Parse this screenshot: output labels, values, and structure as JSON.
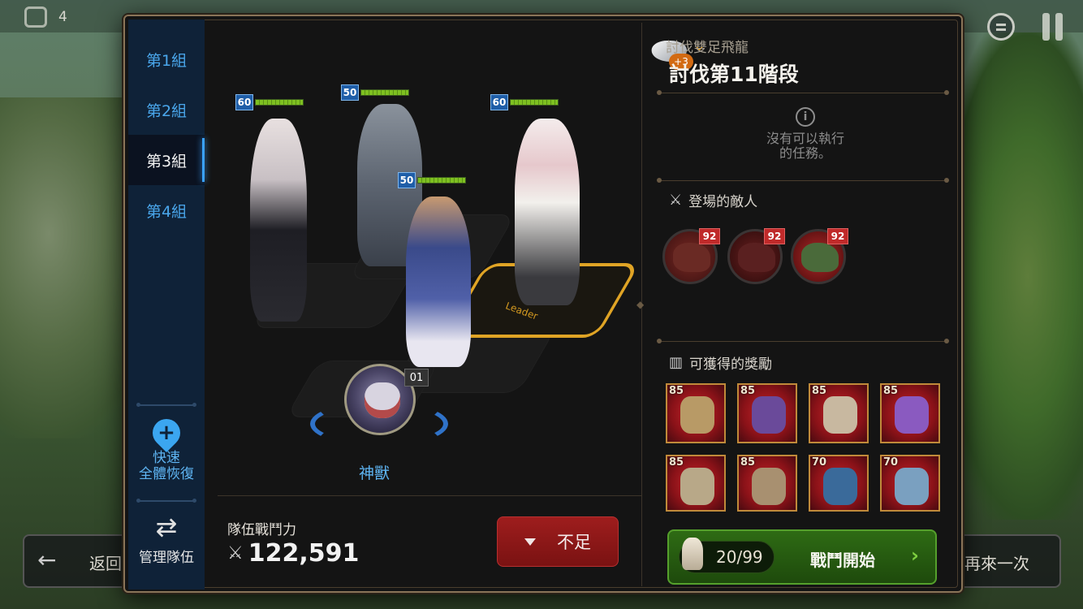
{
  "background": {
    "top_stat_value": "4",
    "back_label": "返回",
    "retry_label": "再來一次"
  },
  "tabs": [
    {
      "label": "第1組",
      "active": false
    },
    {
      "label": "第2組",
      "active": false
    },
    {
      "label": "第3組",
      "active": true
    },
    {
      "label": "第4組",
      "active": false
    }
  ],
  "sidebar": {
    "heal_line1": "快速",
    "heal_line2": "全體恢復",
    "manage_label": "管理隊伍"
  },
  "formation": {
    "buff_badge": "+3",
    "leader_text": "Leader",
    "heroes": [
      {
        "level": "60",
        "hp_percent": 100
      },
      {
        "level": "50",
        "hp_percent": 100
      },
      {
        "level": "60",
        "hp_percent": 100
      },
      {
        "level": "50",
        "hp_percent": 100
      }
    ],
    "beast": {
      "number": "01",
      "name": "神獸"
    }
  },
  "power": {
    "label": "隊伍戰鬥力",
    "value": "122,591"
  },
  "insufficient_label": "不足",
  "stage": {
    "subtitle": "討伐雙足飛龍",
    "title": "討伐第11階段"
  },
  "mission": {
    "line1": "沒有可以執行",
    "line2": "的任務。"
  },
  "enemies": {
    "heading": "登場的敵人",
    "list": [
      {
        "level": "92",
        "color": "#6a2a24"
      },
      {
        "level": "92",
        "color": "#5a2020"
      },
      {
        "level": "92",
        "color": "#4a6a3a"
      }
    ]
  },
  "rewards": {
    "heading": "可獲得的獎勵",
    "items": [
      {
        "level": "85",
        "color": "#b89a66"
      },
      {
        "level": "85",
        "color": "#6a4a9a"
      },
      {
        "level": "85",
        "color": "#c8b8a0"
      },
      {
        "level": "85",
        "color": "#8a5ac0"
      },
      {
        "level": "85",
        "color": "#b8a888"
      },
      {
        "level": "85",
        "color": "#a89070"
      },
      {
        "level": "70",
        "color": "#3a6a9a"
      },
      {
        "level": "70",
        "color": "#7aa0c0"
      }
    ]
  },
  "battle": {
    "cost": "20/99",
    "label": "戰鬥開始"
  }
}
